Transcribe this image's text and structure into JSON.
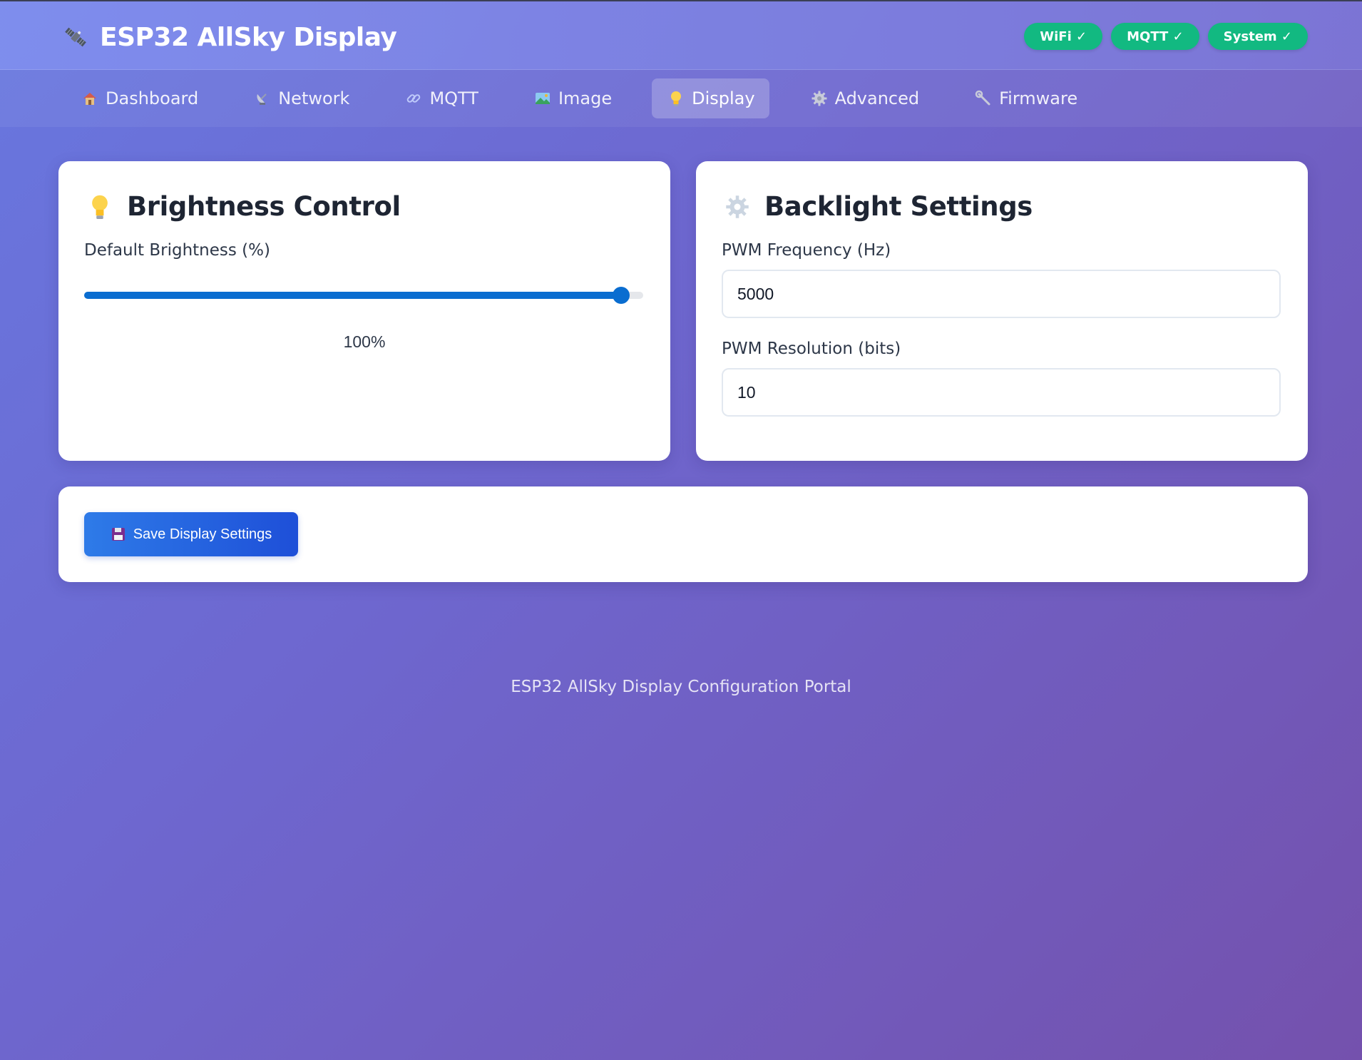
{
  "app": {
    "title": "ESP32 AllSky Display",
    "logo_icon": "satellite-icon"
  },
  "status_badges": [
    {
      "label": "WiFi ✓",
      "color": "#12b981"
    },
    {
      "label": "MQTT ✓",
      "color": "#12b981"
    },
    {
      "label": "System ✓",
      "color": "#12b981"
    }
  ],
  "nav": {
    "active": "Display",
    "tabs": [
      {
        "label": "Dashboard",
        "icon": "house-icon"
      },
      {
        "label": "Network",
        "icon": "satellite-dish-icon"
      },
      {
        "label": "MQTT",
        "icon": "link-icon"
      },
      {
        "label": "Image",
        "icon": "picture-icon"
      },
      {
        "label": "Display",
        "icon": "lightbulb-icon"
      },
      {
        "label": "Advanced",
        "icon": "gear-icon"
      },
      {
        "label": "Firmware",
        "icon": "wrench-icon"
      }
    ]
  },
  "brightness": {
    "title": "Brightness Control",
    "icon": "lightbulb-icon",
    "label": "Default Brightness (%)",
    "value": 100,
    "value_text": "100%",
    "slider_fraction": 0.96
  },
  "backlight": {
    "title": "Backlight Settings",
    "icon": "gear-icon",
    "pwm_frequency_label": "PWM Frequency (Hz)",
    "pwm_frequency_value": "5000",
    "pwm_resolution_label": "PWM Resolution (bits)",
    "pwm_resolution_value": "10"
  },
  "actions": {
    "save_label": "Save Display Settings",
    "save_icon": "floppy-disk-icon"
  },
  "footer": {
    "text": "ESP32 AllSky Display Configuration Portal"
  },
  "colors": {
    "accent": "#0a6dd0",
    "badge": "#12b981",
    "button": "#2563eb"
  }
}
